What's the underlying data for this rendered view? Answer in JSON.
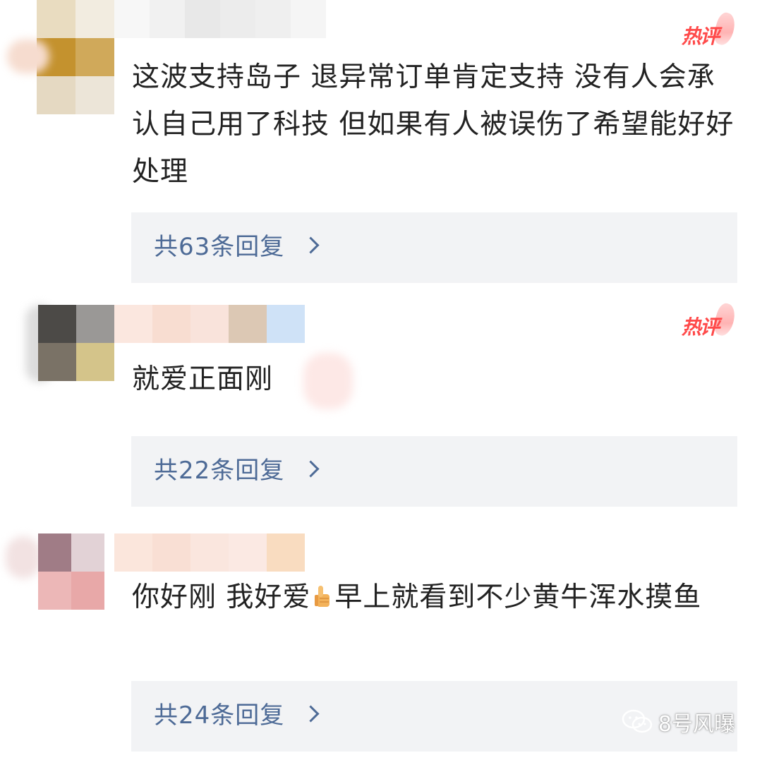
{
  "hot_badge_label": "热评",
  "comments": [
    {
      "text": "这波支持岛子 退异常订单肯定支持 没有人会承认自己用了科技 但如果有人被误伤了希望能好好处理",
      "reply_label": "共63条回复",
      "hot": true
    },
    {
      "text": "就爱正面刚",
      "reply_label": "共22条回复",
      "hot": true
    },
    {
      "text_before_emoji": "你好刚 我好爱",
      "emoji": "thumbs-up-icon",
      "text_after_emoji": "早上就看到不少黄牛浑水摸鱼",
      "reply_label": "共24条回复",
      "hot": false
    }
  ],
  "watermark": {
    "icon": "wechat-icon",
    "text": "8号风曝"
  },
  "colors": {
    "reply_link": "#4d6a96",
    "reply_bg": "#f2f3f5",
    "hot_badge": "#ff4a4a",
    "text": "#222222"
  }
}
